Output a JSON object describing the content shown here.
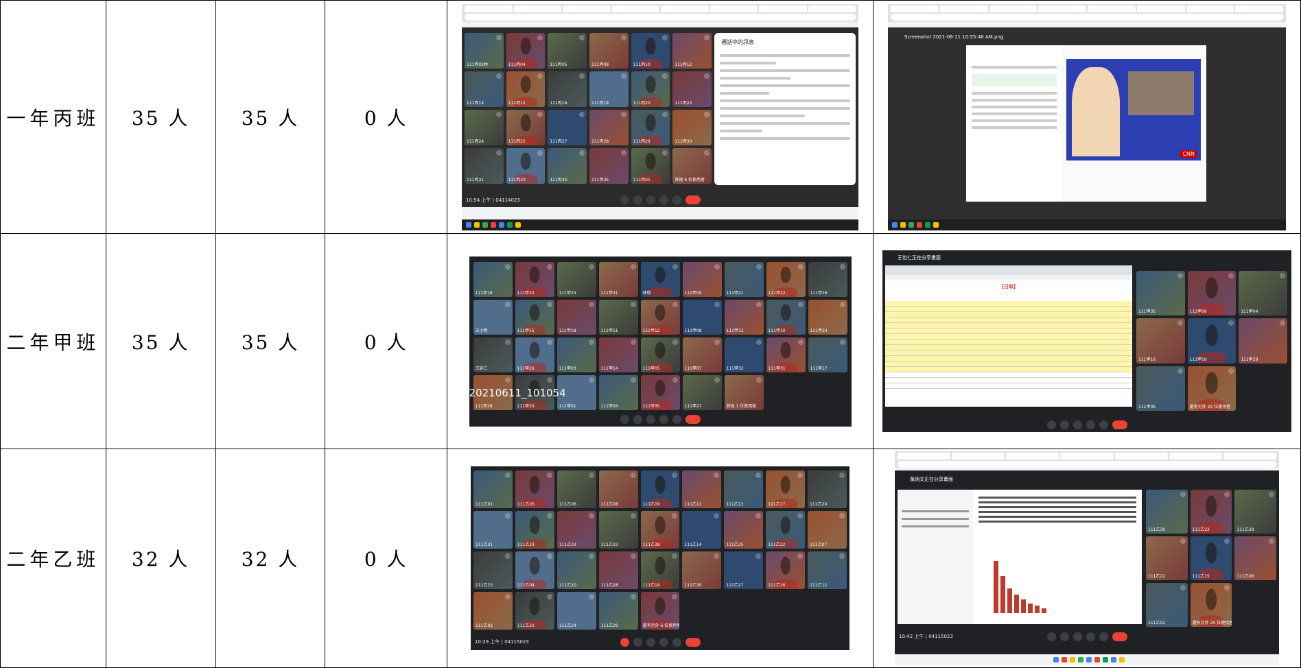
{
  "table": {
    "rows": [
      {
        "class_name": "一年丙班",
        "count_1": "35 人",
        "count_2": "35 人",
        "count_3": "0 人",
        "shot_left": {
          "meeting_time": "10:54 上午 | 04114023",
          "chat_title": "通話中的訊息",
          "tile_names": [
            "111丙02林",
            "111丙04",
            "111丙05",
            "111丙08",
            "111丙10",
            "111丙12",
            "111丙14",
            "111丙15",
            "111丙16",
            "111丙18",
            "111丙20",
            "111丙22",
            "111丙24",
            "111丙25",
            "111丙27",
            "111丙28",
            "111丙29",
            "111丙30",
            "111丙31",
            "111丙33",
            "111丙34",
            "111丙35",
            "111丙01",
            "其他 6 位使用者"
          ]
        },
        "shot_right": {
          "file_title": "Screenshot 2021-06-11 10:55:46 AM.png",
          "news_logo": "CNN"
        }
      },
      {
        "class_name": "二年甲班",
        "count_1": "35 人",
        "count_2": "35 人",
        "count_3": "0 人",
        "shot_left": {
          "overlay_timestamp": "20210611_101054",
          "tile_names": [
            "111甲19",
            "111甲20",
            "111甲24",
            "111甲31",
            "林偉",
            "111甲09",
            "111甲21",
            "111甲22",
            "111甲26",
            "王小明",
            "111甲15",
            "111甲18",
            "111甲11",
            "111甲12",
            "111甲08",
            "111甲13",
            "111甲10",
            "111甲33",
            "王延仁",
            "111甲26",
            "111甲03",
            "111甲14",
            "111甲05",
            "111甲07",
            "111甲32",
            "111甲31",
            "111甲17",
            "111甲28",
            "111甲30",
            "111甲01",
            "111甲34",
            "111甲35",
            "111甲27",
            "其他 1 位使用者"
          ]
        },
        "shot_right": {
          "window_title": "王世仁正在分享畫面",
          "sheet_title": "【日報】",
          "tile_names": [
            "111甲35",
            "111甲06",
            "111甲04",
            "111甲16",
            "111甲10",
            "111甲29",
            "111甲05",
            "還有另外 29 位使用者"
          ]
        }
      },
      {
        "class_name": "二年乙班",
        "count_1": "32 人",
        "count_2": "32 人",
        "count_3": "0 人",
        "shot_left": {
          "meeting_time": "10:29 上午 | 04115023",
          "tile_names": [
            "111乙01",
            "111乙05",
            "111乙06",
            "111乙08",
            "111乙09",
            "111乙11",
            "111乙13",
            "111乙17",
            "111乙20",
            "111乙31",
            "111乙19",
            "111乙03",
            "111乙33",
            "111乙38",
            "111乙14",
            "111乙25",
            "111乙22",
            "111乙07",
            "111乙15",
            "111乙04",
            "111乙10",
            "111乙28",
            "111乙18",
            "111乙30",
            "111乙27",
            "111乙16",
            "111乙12",
            "111乙02",
            "111乙21",
            "111乙24",
            "111乙29",
            "還有另外 6 位使用者"
          ]
        },
        "shot_right": {
          "presenter_banner": "黃炳文正在分享畫面",
          "meeting_time": "10:42 上午 | 04115023",
          "tile_names": [
            "111乙30",
            "111乙23",
            "111乙28",
            "111乙22",
            "111乙15",
            "111乙08",
            "111乙02",
            "還有另外 20 位使用者"
          ]
        }
      }
    ]
  },
  "colors": {
    "meet_background": "#202124",
    "end_call": "#ea4335",
    "sheet_highlight": "#fff5a8"
  }
}
